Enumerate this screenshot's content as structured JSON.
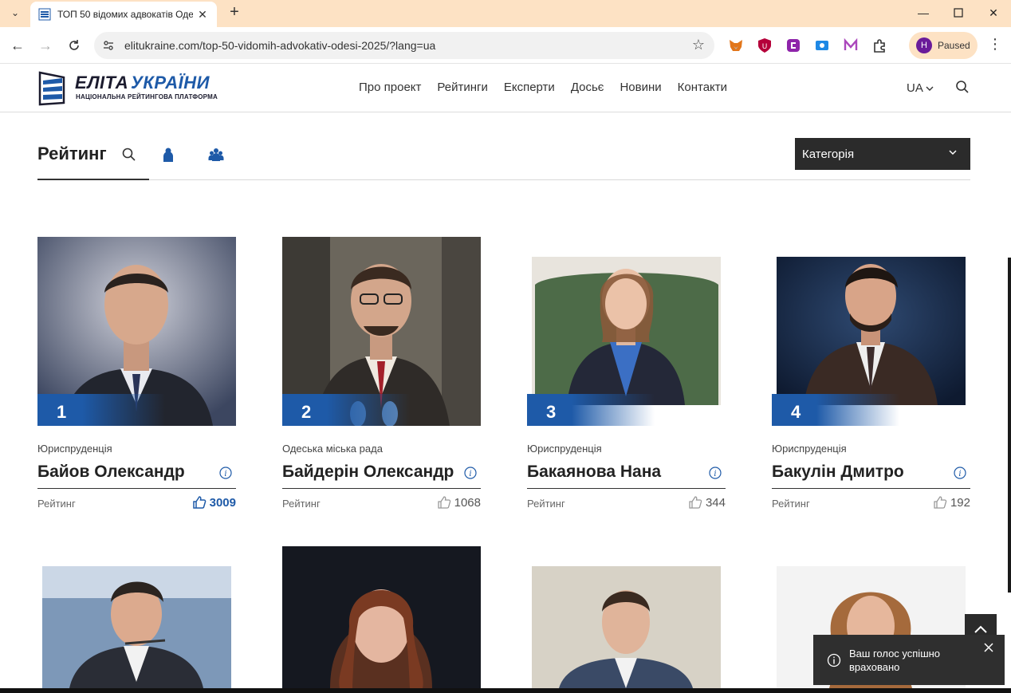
{
  "browser": {
    "tab_title": "ТОП 50 відомих адвокатів Оде",
    "url": "elitukraine.com/top-50-vidomih-advokativ-odesi-2025/?lang=ua",
    "profile_initial": "H",
    "profile_status": "Paused",
    "extensions": [
      "metamask-icon",
      "ublock-icon",
      "clipboard-ext-icon",
      "screen-ext-icon",
      "m-ext-icon",
      "puzzle-extensions-icon"
    ]
  },
  "site": {
    "logo_word_1": "ЕЛІТА",
    "logo_word_2": "УКРАЇНИ",
    "logo_subtitle": "НАЦІОНАЛЬНА РЕЙТИНГОВА ПЛАТФОРМА",
    "nav": [
      "Про проект",
      "Рейтинги",
      "Експерти",
      "Досьє",
      "Новини",
      "Контакти"
    ],
    "lang": "UA",
    "brand_color": "#1e5aa8"
  },
  "rating_bar": {
    "title": "Рейтинг",
    "category_select": "Категорія"
  },
  "cards": [
    {
      "rank": "1",
      "category": "Юриспруденція",
      "name": "Байов Олександр",
      "rating_label": "Рейтинг",
      "votes": "3009"
    },
    {
      "rank": "2",
      "category": "Одеська міська рада",
      "name": "Байдерін Олександр",
      "rating_label": "Рейтинг",
      "votes": "1068"
    },
    {
      "rank": "3",
      "category": "Юриспруденція",
      "name": "Бакаянова Нана",
      "rating_label": "Рейтинг",
      "votes": "344"
    },
    {
      "rank": "4",
      "category": "Юриспруденція",
      "name": "Бакулін Дмитро",
      "rating_label": "Рейтинг",
      "votes": "192"
    }
  ],
  "toast": {
    "message": "Ваш голос успішно враховано"
  }
}
